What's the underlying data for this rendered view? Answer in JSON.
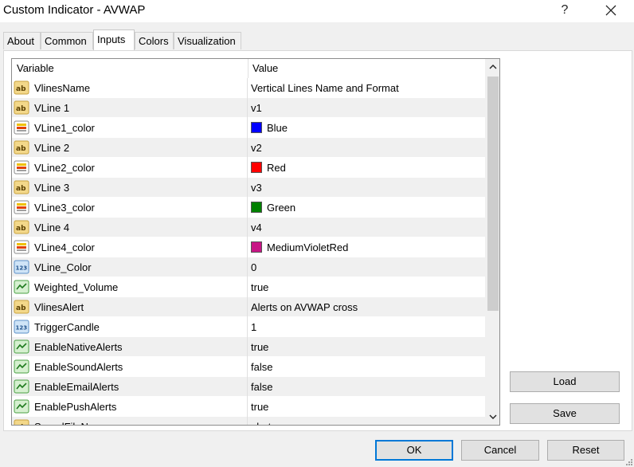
{
  "window": {
    "title": "Custom Indicator - AVWAP",
    "help_label": "?"
  },
  "tabs": [
    {
      "label": "About"
    },
    {
      "label": "Common"
    },
    {
      "label": "Inputs"
    },
    {
      "label": "Colors"
    },
    {
      "label": "Visualization"
    }
  ],
  "grid": {
    "columns": {
      "variable": "Variable",
      "value": "Value"
    },
    "rows": [
      {
        "icon": "ab-string-icon",
        "variable": "VlinesName",
        "value": "Vertical Lines Name and Format"
      },
      {
        "icon": "ab-string-icon",
        "variable": "VLine 1",
        "value": "v1"
      },
      {
        "icon": "color-icon",
        "variable": "VLine1_color",
        "value": "Blue",
        "swatch": "#0000ff"
      },
      {
        "icon": "ab-string-icon",
        "variable": "VLine 2",
        "value": "v2"
      },
      {
        "icon": "color-icon",
        "variable": "VLine2_color",
        "value": "Red",
        "swatch": "#ff0000"
      },
      {
        "icon": "ab-string-icon",
        "variable": "VLine 3",
        "value": "v3"
      },
      {
        "icon": "color-icon",
        "variable": "VLine3_color",
        "value": "Green",
        "swatch": "#008000"
      },
      {
        "icon": "ab-string-icon",
        "variable": "VLine 4",
        "value": "v4"
      },
      {
        "icon": "color-icon",
        "variable": "VLine4_color",
        "value": "MediumVioletRed",
        "swatch": "#c71585"
      },
      {
        "icon": "123-number-icon",
        "variable": "VLine_Color",
        "value": "0"
      },
      {
        "icon": "bool-icon",
        "variable": "Weighted_Volume",
        "value": "true"
      },
      {
        "icon": "ab-string-icon",
        "variable": "VlinesAlert",
        "value": "Alerts on AVWAP cross"
      },
      {
        "icon": "123-number-icon",
        "variable": "TriggerCandle",
        "value": "1"
      },
      {
        "icon": "bool-icon",
        "variable": "EnableNativeAlerts",
        "value": "true"
      },
      {
        "icon": "bool-icon",
        "variable": "EnableSoundAlerts",
        "value": "false"
      },
      {
        "icon": "bool-icon",
        "variable": "EnableEmailAlerts",
        "value": "false"
      },
      {
        "icon": "bool-icon",
        "variable": "EnablePushAlerts",
        "value": "true"
      },
      {
        "icon": "ab-string-icon",
        "variable": "SoundFileName",
        "value": "alert"
      }
    ]
  },
  "side_buttons": {
    "load": "Load",
    "save": "Save"
  },
  "bottom_buttons": {
    "ok": "OK",
    "cancel": "Cancel",
    "reset": "Reset"
  }
}
